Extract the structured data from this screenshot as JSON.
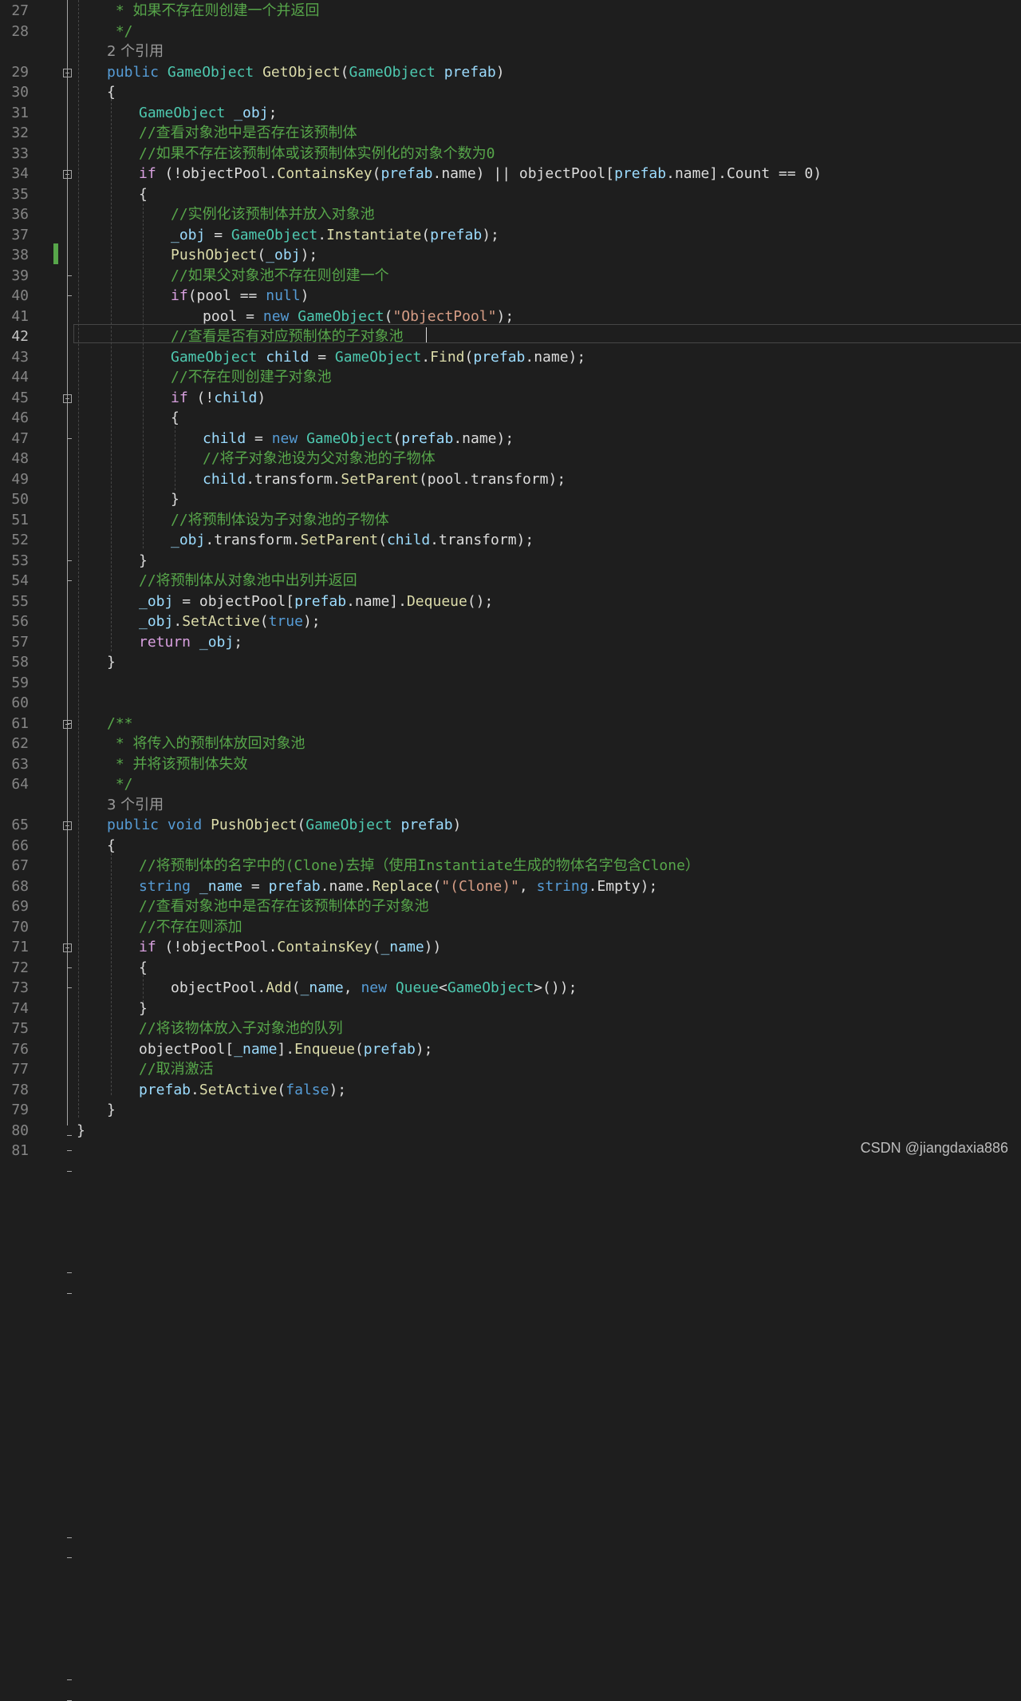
{
  "editor": {
    "current_line": "42",
    "lines": [
      {
        "n": "27",
        "indent": 1,
        "tokens": [
          {
            "t": " * 如果不存在则创建一个并返回",
            "c": "cm"
          }
        ]
      },
      {
        "n": "28",
        "indent": 1,
        "tokens": [
          {
            "t": " */",
            "c": "cm"
          }
        ]
      },
      {
        "n": "",
        "ref": "2 个引用"
      },
      {
        "n": "29",
        "indent": 1,
        "tokens": [
          {
            "t": "public",
            "c": "kw"
          },
          {
            "t": " "
          },
          {
            "t": "GameObject",
            "c": "ty"
          },
          {
            "t": " "
          },
          {
            "t": "GetObject",
            "c": "fn"
          },
          {
            "t": "("
          },
          {
            "t": "GameObject",
            "c": "ty"
          },
          {
            "t": " "
          },
          {
            "t": "prefab",
            "c": "pa"
          },
          {
            "t": ")"
          }
        ]
      },
      {
        "n": "30",
        "indent": 1,
        "tokens": [
          {
            "t": "{"
          }
        ]
      },
      {
        "n": "31",
        "indent": 2,
        "tokens": [
          {
            "t": "GameObject",
            "c": "ty"
          },
          {
            "t": " "
          },
          {
            "t": "_obj",
            "c": "lv"
          },
          {
            "t": ";"
          }
        ]
      },
      {
        "n": "32",
        "indent": 2,
        "tokens": [
          {
            "t": "//查看对象池中是否存在该预制体",
            "c": "cm"
          }
        ]
      },
      {
        "n": "33",
        "indent": 2,
        "tokens": [
          {
            "t": "//如果不存在该预制体或该预制体实例化的对象个数为0",
            "c": "cm"
          }
        ]
      },
      {
        "n": "34",
        "indent": 2,
        "tokens": [
          {
            "t": "if",
            "c": "ctl"
          },
          {
            "t": " (!objectPool."
          },
          {
            "t": "ContainsKey",
            "c": "fn"
          },
          {
            "t": "("
          },
          {
            "t": "prefab",
            "c": "pa"
          },
          {
            "t": ".name) || objectPool["
          },
          {
            "t": "prefab",
            "c": "pa"
          },
          {
            "t": ".name].Count == 0)"
          }
        ]
      },
      {
        "n": "35",
        "indent": 2,
        "tokens": [
          {
            "t": "{"
          }
        ]
      },
      {
        "n": "36",
        "indent": 3,
        "tokens": [
          {
            "t": "//实例化该预制体并放入对象池",
            "c": "cm"
          }
        ]
      },
      {
        "n": "37",
        "indent": 3,
        "tokens": [
          {
            "t": "_obj",
            "c": "lv"
          },
          {
            "t": " = "
          },
          {
            "t": "GameObject",
            "c": "ty"
          },
          {
            "t": "."
          },
          {
            "t": "Instantiate",
            "c": "fn"
          },
          {
            "t": "("
          },
          {
            "t": "prefab",
            "c": "pa"
          },
          {
            "t": ");"
          }
        ]
      },
      {
        "n": "38",
        "indent": 3,
        "tokens": [
          {
            "t": "PushObject",
            "c": "fn"
          },
          {
            "t": "("
          },
          {
            "t": "_obj",
            "c": "lv"
          },
          {
            "t": ");"
          }
        ]
      },
      {
        "n": "39",
        "indent": 3,
        "tokens": [
          {
            "t": "//如果父对象池不存在则创建一个",
            "c": "cm"
          }
        ]
      },
      {
        "n": "40",
        "indent": 3,
        "tokens": [
          {
            "t": "if",
            "c": "ctl"
          },
          {
            "t": "(pool == "
          },
          {
            "t": "null",
            "c": "kw"
          },
          {
            "t": ")"
          }
        ]
      },
      {
        "n": "41",
        "indent": 4,
        "tokens": [
          {
            "t": "pool = "
          },
          {
            "t": "new",
            "c": "kw"
          },
          {
            "t": " "
          },
          {
            "t": "GameObject",
            "c": "ty"
          },
          {
            "t": "("
          },
          {
            "t": "\"ObjectPool\"",
            "c": "st"
          },
          {
            "t": ");"
          }
        ]
      },
      {
        "n": "42",
        "indent": 3,
        "tokens": [
          {
            "t": "//查看是否有对应预制体的子对象池",
            "c": "cm"
          }
        ]
      },
      {
        "n": "43",
        "indent": 3,
        "tokens": [
          {
            "t": "GameObject",
            "c": "ty"
          },
          {
            "t": " "
          },
          {
            "t": "child",
            "c": "lv"
          },
          {
            "t": " = "
          },
          {
            "t": "GameObject",
            "c": "ty"
          },
          {
            "t": "."
          },
          {
            "t": "Find",
            "c": "fn"
          },
          {
            "t": "("
          },
          {
            "t": "prefab",
            "c": "pa"
          },
          {
            "t": ".name);"
          }
        ]
      },
      {
        "n": "44",
        "indent": 3,
        "tokens": [
          {
            "t": "//不存在则创建子对象池",
            "c": "cm"
          }
        ]
      },
      {
        "n": "45",
        "indent": 3,
        "tokens": [
          {
            "t": "if",
            "c": "ctl"
          },
          {
            "t": " (!"
          },
          {
            "t": "child",
            "c": "lv"
          },
          {
            "t": ")"
          }
        ]
      },
      {
        "n": "46",
        "indent": 3,
        "tokens": [
          {
            "t": "{"
          }
        ]
      },
      {
        "n": "47",
        "indent": 4,
        "tokens": [
          {
            "t": "child",
            "c": "lv"
          },
          {
            "t": " = "
          },
          {
            "t": "new",
            "c": "kw"
          },
          {
            "t": " "
          },
          {
            "t": "GameObject",
            "c": "ty"
          },
          {
            "t": "("
          },
          {
            "t": "prefab",
            "c": "pa"
          },
          {
            "t": ".name);"
          }
        ]
      },
      {
        "n": "48",
        "indent": 4,
        "tokens": [
          {
            "t": "//将子对象池设为父对象池的子物体",
            "c": "cm"
          }
        ]
      },
      {
        "n": "49",
        "indent": 4,
        "tokens": [
          {
            "t": "child",
            "c": "lv"
          },
          {
            "t": ".transform."
          },
          {
            "t": "SetParent",
            "c": "fn"
          },
          {
            "t": "(pool.transform);"
          }
        ]
      },
      {
        "n": "50",
        "indent": 3,
        "tokens": [
          {
            "t": "}"
          }
        ]
      },
      {
        "n": "51",
        "indent": 3,
        "tokens": [
          {
            "t": "//将预制体设为子对象池的子物体",
            "c": "cm"
          }
        ]
      },
      {
        "n": "52",
        "indent": 3,
        "tokens": [
          {
            "t": "_obj",
            "c": "lv"
          },
          {
            "t": ".transform."
          },
          {
            "t": "SetParent",
            "c": "fn"
          },
          {
            "t": "("
          },
          {
            "t": "child",
            "c": "lv"
          },
          {
            "t": ".transform);"
          }
        ]
      },
      {
        "n": "53",
        "indent": 2,
        "tokens": [
          {
            "t": "}"
          }
        ]
      },
      {
        "n": "54",
        "indent": 2,
        "tokens": [
          {
            "t": "//将预制体从对象池中出列并返回",
            "c": "cm"
          }
        ]
      },
      {
        "n": "55",
        "indent": 2,
        "tokens": [
          {
            "t": "_obj",
            "c": "lv"
          },
          {
            "t": " = objectPool["
          },
          {
            "t": "prefab",
            "c": "pa"
          },
          {
            "t": ".name]."
          },
          {
            "t": "Dequeue",
            "c": "fn"
          },
          {
            "t": "();"
          }
        ]
      },
      {
        "n": "56",
        "indent": 2,
        "tokens": [
          {
            "t": "_obj",
            "c": "lv"
          },
          {
            "t": "."
          },
          {
            "t": "SetActive",
            "c": "fn"
          },
          {
            "t": "("
          },
          {
            "t": "true",
            "c": "kw"
          },
          {
            "t": ");"
          }
        ]
      },
      {
        "n": "57",
        "indent": 2,
        "tokens": [
          {
            "t": "return",
            "c": "ctl"
          },
          {
            "t": " "
          },
          {
            "t": "_obj",
            "c": "lv"
          },
          {
            "t": ";"
          }
        ]
      },
      {
        "n": "58",
        "indent": 1,
        "tokens": [
          {
            "t": "}"
          }
        ]
      },
      {
        "n": "59",
        "indent": 0,
        "tokens": []
      },
      {
        "n": "60",
        "indent": 0,
        "tokens": []
      },
      {
        "n": "61",
        "indent": 1,
        "tokens": [
          {
            "t": "/**",
            "c": "cm"
          }
        ]
      },
      {
        "n": "62",
        "indent": 1,
        "tokens": [
          {
            "t": " * 将传入的预制体放回对象池",
            "c": "cm"
          }
        ]
      },
      {
        "n": "63",
        "indent": 1,
        "tokens": [
          {
            "t": " * 并将该预制体失效",
            "c": "cm"
          }
        ]
      },
      {
        "n": "64",
        "indent": 1,
        "tokens": [
          {
            "t": " */",
            "c": "cm"
          }
        ]
      },
      {
        "n": "",
        "ref": "3 个引用"
      },
      {
        "n": "65",
        "indent": 1,
        "tokens": [
          {
            "t": "public",
            "c": "kw"
          },
          {
            "t": " "
          },
          {
            "t": "void",
            "c": "kw"
          },
          {
            "t": " "
          },
          {
            "t": "PushObject",
            "c": "fn"
          },
          {
            "t": "("
          },
          {
            "t": "GameObject",
            "c": "ty"
          },
          {
            "t": " "
          },
          {
            "t": "prefab",
            "c": "pa"
          },
          {
            "t": ")"
          }
        ]
      },
      {
        "n": "66",
        "indent": 1,
        "tokens": [
          {
            "t": "{"
          }
        ]
      },
      {
        "n": "67",
        "indent": 2,
        "tokens": [
          {
            "t": "//将预制体的名字中的(Clone)去掉（使用Instantiate生成的物体名字包含Clone）",
            "c": "cm"
          }
        ]
      },
      {
        "n": "68",
        "indent": 2,
        "tokens": [
          {
            "t": "string",
            "c": "kw"
          },
          {
            "t": " "
          },
          {
            "t": "_name",
            "c": "lv"
          },
          {
            "t": " = "
          },
          {
            "t": "prefab",
            "c": "pa"
          },
          {
            "t": ".name."
          },
          {
            "t": "Replace",
            "c": "fn"
          },
          {
            "t": "("
          },
          {
            "t": "\"(Clone)\"",
            "c": "st"
          },
          {
            "t": ", "
          },
          {
            "t": "string",
            "c": "kw"
          },
          {
            "t": ".Empty);"
          }
        ]
      },
      {
        "n": "69",
        "indent": 2,
        "tokens": [
          {
            "t": "//查看对象池中是否存在该预制体的子对象池",
            "c": "cm"
          }
        ]
      },
      {
        "n": "70",
        "indent": 2,
        "tokens": [
          {
            "t": "//不存在则添加",
            "c": "cm"
          }
        ]
      },
      {
        "n": "71",
        "indent": 2,
        "tokens": [
          {
            "t": "if",
            "c": "ctl"
          },
          {
            "t": " (!objectPool."
          },
          {
            "t": "ContainsKey",
            "c": "fn"
          },
          {
            "t": "("
          },
          {
            "t": "_name",
            "c": "lv"
          },
          {
            "t": "))"
          }
        ]
      },
      {
        "n": "72",
        "indent": 2,
        "tokens": [
          {
            "t": "{"
          }
        ]
      },
      {
        "n": "73",
        "indent": 3,
        "tokens": [
          {
            "t": "objectPool."
          },
          {
            "t": "Add",
            "c": "fn"
          },
          {
            "t": "("
          },
          {
            "t": "_name",
            "c": "lv"
          },
          {
            "t": ", "
          },
          {
            "t": "new",
            "c": "kw"
          },
          {
            "t": " "
          },
          {
            "t": "Queue",
            "c": "ty"
          },
          {
            "t": "<"
          },
          {
            "t": "GameObject",
            "c": "ty"
          },
          {
            "t": ">());"
          }
        ]
      },
      {
        "n": "74",
        "indent": 2,
        "tokens": [
          {
            "t": "}"
          }
        ]
      },
      {
        "n": "75",
        "indent": 2,
        "tokens": [
          {
            "t": "//将该物体放入子对象池的队列",
            "c": "cm"
          }
        ]
      },
      {
        "n": "76",
        "indent": 2,
        "tokens": [
          {
            "t": "objectPool["
          },
          {
            "t": "_name",
            "c": "lv"
          },
          {
            "t": "]."
          },
          {
            "t": "Enqueue",
            "c": "fn"
          },
          {
            "t": "("
          },
          {
            "t": "prefab",
            "c": "pa"
          },
          {
            "t": ");"
          }
        ]
      },
      {
        "n": "77",
        "indent": 2,
        "tokens": [
          {
            "t": "//取消激活",
            "c": "cm"
          }
        ]
      },
      {
        "n": "78",
        "indent": 2,
        "tokens": [
          {
            "t": "prefab",
            "c": "pa"
          },
          {
            "t": "."
          },
          {
            "t": "SetActive",
            "c": "fn"
          },
          {
            "t": "("
          },
          {
            "t": "false",
            "c": "kw"
          },
          {
            "t": ");"
          }
        ]
      },
      {
        "n": "79",
        "indent": 1,
        "tokens": [
          {
            "t": "}"
          }
        ]
      },
      {
        "n": "80",
        "indent": 0,
        "tokens": [
          {
            "t": "}"
          }
        ]
      },
      {
        "n": "81",
        "indent": 0,
        "tokens": []
      }
    ],
    "fold_markers": [
      "29",
      "34",
      "45",
      "61",
      "65",
      "71"
    ]
  },
  "theme": {
    "background": "#1e1e1e",
    "keyword": "#569cd6",
    "type": "#4ec9b0",
    "method": "#dcdcaa",
    "comment": "#57a64a",
    "string": "#d69d85",
    "control": "#d8a0df",
    "line_number": "#858585"
  },
  "watermark": "CSDN @jiangdaxia886"
}
